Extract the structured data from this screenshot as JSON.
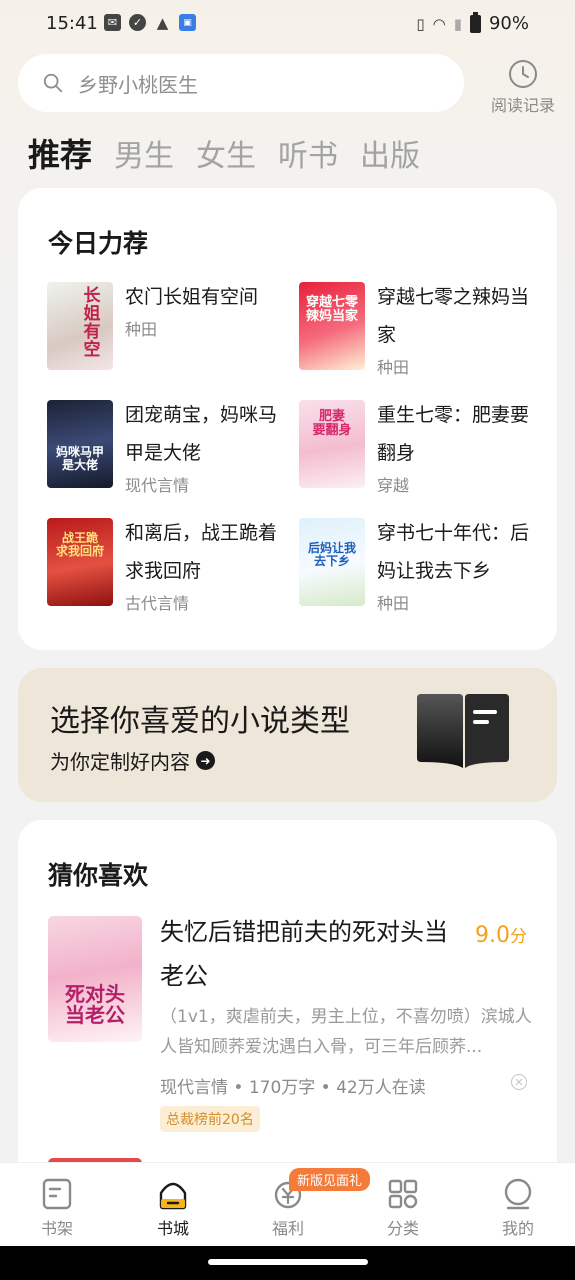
{
  "status_bar": {
    "time": "15:41",
    "battery": "90%"
  },
  "search": {
    "placeholder": "乡野小桃医生"
  },
  "history": {
    "label": "阅读记录"
  },
  "tabs": [
    "推荐",
    "男生",
    "女生",
    "听书",
    "出版"
  ],
  "today": {
    "title": "今日力荐",
    "items": [
      {
        "title": "农门长姐有空间",
        "tag": "种田"
      },
      {
        "title": "穿越七零之辣妈当家",
        "tag": "种田"
      },
      {
        "title": "团宠萌宝，妈咪马甲是大佬",
        "tag": "现代言情"
      },
      {
        "title": "重生七零：肥妻要翻身",
        "tag": "穿越"
      },
      {
        "title": "和离后，战王跪着求我回府",
        "tag": "古代言情"
      },
      {
        "title": "穿书七十年代：后妈让我去下乡",
        "tag": "种田"
      }
    ]
  },
  "banner": {
    "title": "选择你喜爱的小说类型",
    "subtitle": "为你定制好内容"
  },
  "guess": {
    "title": "猜你喜欢",
    "book": {
      "title": "失忆后错把前夫的死对头当老公",
      "score": "9.0",
      "score_unit": "分",
      "desc": "（1v1，爽虐前夫，男主上位，不喜勿喷）滨城人人皆知顾荞爱沈遇白入骨，可三年后顾荞...",
      "meta": "现代言情 • 170万字 • 42万人在读",
      "badge": "总裁榜前20名"
    }
  },
  "nav": {
    "items": [
      {
        "label": "书架"
      },
      {
        "label": "书城"
      },
      {
        "label": "福利"
      },
      {
        "label": "分类"
      },
      {
        "label": "我的"
      }
    ],
    "promo": "新版见面礼"
  },
  "colors": {
    "accent": "#f0a21b",
    "promo": "#f47b3a",
    "banner": "#efe6da"
  }
}
